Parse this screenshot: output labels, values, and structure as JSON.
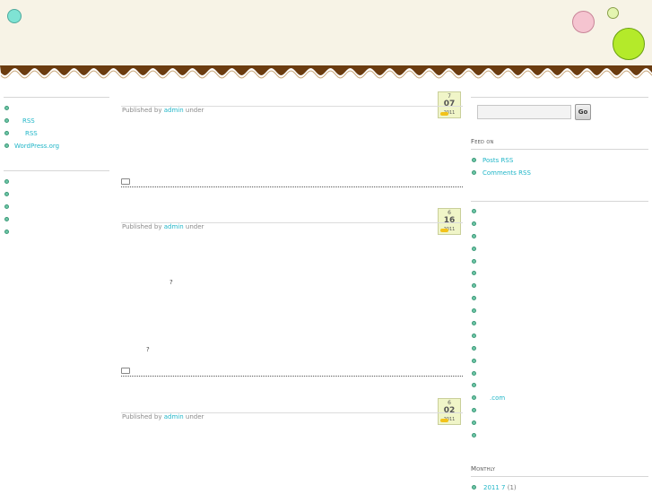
{
  "left_sidebar": {
    "widget1": {
      "items": [
        {
          "label": ""
        },
        {
          "label": "RSS"
        },
        {
          "label": "RSS"
        },
        {
          "label": "WordPress.org"
        }
      ]
    },
    "widget2": {
      "items": [
        {
          "label": ""
        },
        {
          "label": ""
        },
        {
          "label": ""
        },
        {
          "label": ""
        },
        {
          "label": ""
        }
      ]
    }
  },
  "posts": [
    {
      "date": {
        "month": "7",
        "day": "07",
        "year": "2011"
      },
      "meta": {
        "prefix": "Published by",
        "author": "admin",
        "suffix": "under"
      }
    },
    {
      "date": {
        "month": "6",
        "day": "16",
        "year": "2011"
      },
      "meta": {
        "prefix": "Published by",
        "author": "admin",
        "suffix": "under"
      },
      "body_marks": [
        "?",
        "?"
      ]
    },
    {
      "date": {
        "month": "6",
        "day": "02",
        "year": "2011"
      },
      "meta": {
        "prefix": "Published by",
        "author": "admin",
        "suffix": "under"
      }
    }
  ],
  "right_sidebar": {
    "search": {
      "placeholder": "",
      "button_label": "Go"
    },
    "feed": {
      "title": "Feed on",
      "items": [
        {
          "label": "Posts RSS"
        },
        {
          "label": "Comments RSS"
        }
      ]
    },
    "categories": {
      "items": [
        {
          "label": ""
        },
        {
          "label": ""
        },
        {
          "label": ""
        },
        {
          "label": ""
        },
        {
          "label": ""
        },
        {
          "label": ""
        },
        {
          "label": ""
        },
        {
          "label": ""
        },
        {
          "label": ""
        },
        {
          "label": ""
        },
        {
          "label": ""
        },
        {
          "label": ""
        },
        {
          "label": ""
        },
        {
          "label": ""
        },
        {
          "label": ""
        },
        {
          "label": ".com"
        },
        {
          "label": ""
        },
        {
          "label": ""
        },
        {
          "label": ""
        }
      ]
    },
    "monthly": {
      "title": "Monthly",
      "items": [
        {
          "label": "2011 7",
          "count": "(1)"
        }
      ]
    }
  },
  "colors": {
    "header_bg": "#f7f3e6",
    "scallop": "#6b3c10",
    "link": "#21b6c8",
    "bullet": "#6fc6a8",
    "date_badge": "#f0f5c8"
  }
}
